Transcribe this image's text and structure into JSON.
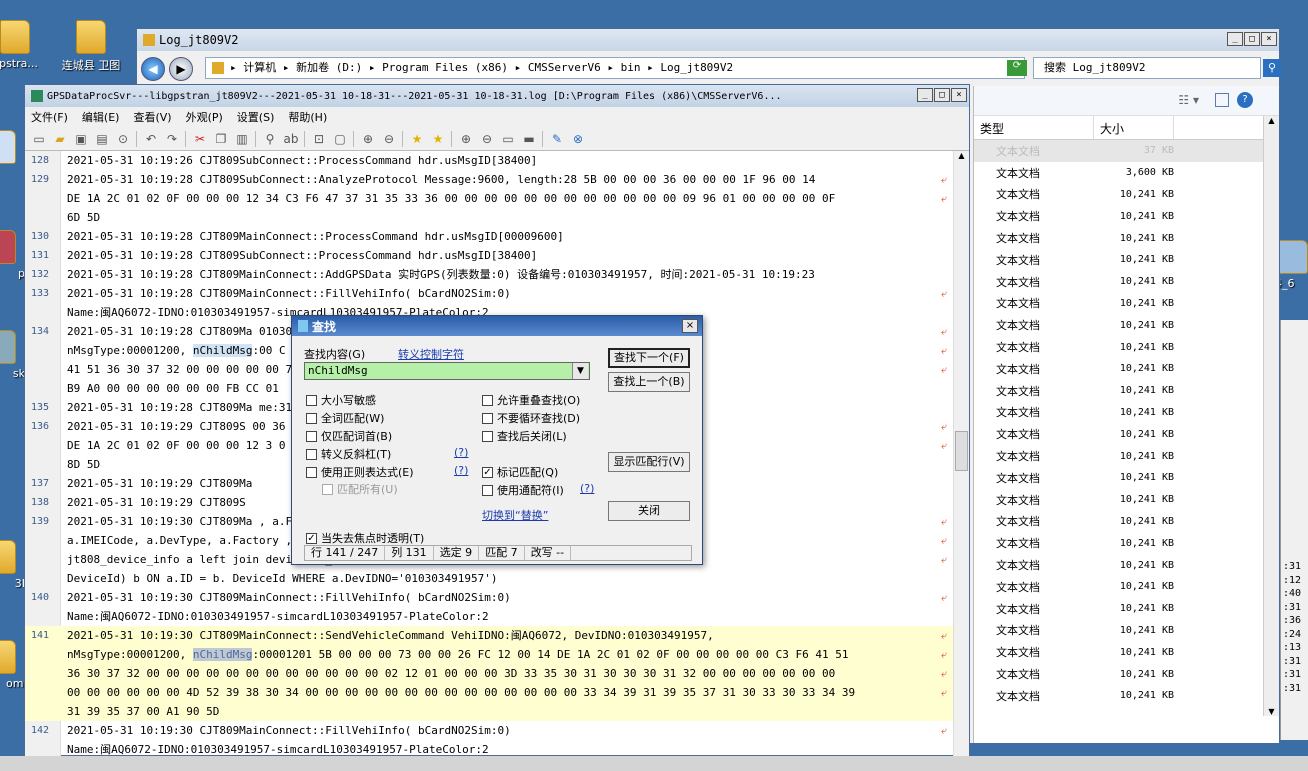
{
  "desktop": {
    "icons": [
      {
        "label": "gpstra..."
      },
      {
        "label": "连城县 卫图"
      },
      {
        "label": "lic"
      },
      {
        "label": "pto"
      },
      {
        "label": "skto"
      },
      {
        "label": "3Ds"
      },
      {
        "label": "omse"
      }
    ],
    "right_labels": [
      "64_6"
    ]
  },
  "explorer": {
    "title": "Log_jt809V2",
    "path_parts": [
      "计算机",
      "新加卷 (D:)",
      "Program Files (x86)",
      "CMSServerV6",
      "bin",
      "Log_jt809V2"
    ],
    "search_placeholder": "搜索 Log_jt809V2",
    "columns": {
      "type": "类型",
      "size": "大小"
    },
    "files": [
      {
        "type": "文本文档",
        "size": "37 KB"
      },
      {
        "type": "文本文档",
        "size": "3,600 KB"
      },
      {
        "type": "文本文档",
        "size": "10,241 KB"
      },
      {
        "type": "文本文档",
        "size": "10,241 KB"
      },
      {
        "type": "文本文档",
        "size": "10,241 KB"
      },
      {
        "type": "文本文档",
        "size": "10,241 KB"
      },
      {
        "type": "文本文档",
        "size": "10,241 KB"
      },
      {
        "type": "文本文档",
        "size": "10,241 KB"
      },
      {
        "type": "文本文档",
        "size": "10,241 KB"
      },
      {
        "type": "文本文档",
        "size": "10,241 KB"
      },
      {
        "type": "文本文档",
        "size": "10,241 KB"
      },
      {
        "type": "文本文档",
        "size": "10,241 KB"
      },
      {
        "type": "文本文档",
        "size": "10,241 KB"
      },
      {
        "type": "文本文档",
        "size": "10,241 KB"
      },
      {
        "type": "文本文档",
        "size": "10,241 KB"
      },
      {
        "type": "文本文档",
        "size": "10,241 KB"
      },
      {
        "type": "文本文档",
        "size": "10,241 KB"
      },
      {
        "type": "文本文档",
        "size": "10,241 KB"
      },
      {
        "type": "文本文档",
        "size": "10,241 KB"
      },
      {
        "type": "文本文档",
        "size": "10,241 KB"
      },
      {
        "type": "文本文档",
        "size": "10,241 KB"
      },
      {
        "type": "文本文档",
        "size": "10,241 KB"
      },
      {
        "type": "文本文档",
        "size": "10,241 KB"
      },
      {
        "type": "文本文档",
        "size": "10,241 KB"
      },
      {
        "type": "文本文档",
        "size": "10,241 KB"
      },
      {
        "type": "文本文档",
        "size": "10,241 KB"
      }
    ],
    "edge_times": [
      ":31",
      ":12",
      ":40",
      ":31",
      ":36",
      ":24",
      ":13",
      ":31",
      ":31",
      ":31"
    ]
  },
  "editor": {
    "title": "GPSDataProcSvr---libgpstran_jt809V2---2021-05-31 10-18-31---2021-05-31 10-18-31.log [D:\\Program Files (x86)\\CMSServerV6...",
    "menu": [
      "文件(F)",
      "编辑(E)",
      "查看(V)",
      "外观(P)",
      "设置(S)",
      "帮助(H)"
    ],
    "lines": [
      {
        "n": "128",
        "t": "2021-05-31   10:19:26   CJT809SubConnect::ProcessCommand hdr.usMsgID[38400]",
        "wrap": false
      },
      {
        "n": "129",
        "t": "2021-05-31   10:19:28   CJT809SubConnect::AnalyzeProtocol Message:9600, length:28  5B 00 00 00 36 00 00 00 1F 96 00 14",
        "wrap": true
      },
      {
        "n": "",
        "t": "DE 1A 2C 01 02 0F 00 00 00 12 34 C3 F6 47 37 31 35 33 36 00 00 00 00 00 00 00 00 00 00 00 00 09 96 01 00 00 00 00 0F",
        "wrap": true
      },
      {
        "n": "",
        "t": "6D 5D",
        "wrap": false
      },
      {
        "n": "130",
        "t": "2021-05-31   10:19:28   CJT809MainConnect::ProcessCommand hdr.usMsgID[00009600]",
        "wrap": false
      },
      {
        "n": "131",
        "t": "2021-05-31   10:19:28   CJT809SubConnect::ProcessCommand hdr.usMsgID[38400]",
        "wrap": false
      },
      {
        "n": "132",
        "t": "2021-05-31   10:19:28   CJT809MainConnect::AddGPSData 实时GPS(列表数量:0) 设备编号:010303491957, 时间:2021-05-31 10:19:23",
        "wrap": false
      },
      {
        "n": "133",
        "t": "2021-05-31   10:19:28   CJT809MainConnect::FillVehiInfo( bCardNO2Sim:0)",
        "wrap": true
      },
      {
        "n": "",
        "t": "Name:闽AQ6072-IDNO:010303491957-simcardL10303491957-PlateColor:2",
        "wrap": false
      },
      {
        "n": "134",
        "t": "2021-05-31   10:19:28   CJT809Ma                                                  010303491957,",
        "wrap": true
      },
      {
        "n": "",
        "t": "nMsgType:00001200, nChildMsg:00                                                   C 01 02 0F 00 00 00 00 00 C3 F6",
        "wrap": true
      },
      {
        "n": "",
        "t": "41 51 36 30 37 32 00 00 00 00 00                                                  7 E5 0A 13 17 07 1C 36 3B 01 8C",
        "wrap": true
      },
      {
        "n": "",
        "t": "B9 A0 00 00 00 00 00 00 FB CC 01",
        "wrap": false
      },
      {
        "n": "135",
        "t": "2021-05-31   10:19:28   CJT809Ma                                                  me:31 10:19:23",
        "wrap": false
      },
      {
        "n": "136",
        "t": "2021-05-31   10:19:29   CJT809S                                                    00 36 00 00 00 20 96 00 14",
        "wrap": true
      },
      {
        "n": "",
        "t": "DE 1A 2C 01 02 0F 00 00 00 12 3                                                  0 00 00 02 96 01 00 00 00 00 C5",
        "wrap": true
      },
      {
        "n": "",
        "t": "8D 5D",
        "wrap": false
      },
      {
        "n": "137",
        "t": "2021-05-31   10:19:29   CJT809Ma",
        "wrap": false
      },
      {
        "n": "138",
        "t": "2021-05-31   10:19:29   CJT809S",
        "wrap": false
      },
      {
        "n": "139",
        "t": "2021-05-31   10:19:30   CJT809Ma                                                  , a.Factory, a.SimCard,",
        "wrap": true
      },
      {
        "n": "",
        "t": "a.IMEICode, a.DevType, a.Factory                                                  , b.chnCount from",
        "wrap": true
      },
      {
        "n": "",
        "t": "jt808_device_info a left join                                                     devicechn_relation GROUP BY",
        "wrap": true
      },
      {
        "n": "",
        "t": "DeviceId) b ON a.ID = b. DeviceId WHERE a.DevIDNO='010303491957')",
        "wrap": false
      },
      {
        "n": "140",
        "t": "2021-05-31   10:19:30   CJT809MainConnect::FillVehiInfo( bCardNO2Sim:0)",
        "wrap": true
      },
      {
        "n": "",
        "t": "Name:闽AQ6072-IDNO:010303491957-simcardL10303491957-PlateColor:2",
        "wrap": false
      },
      {
        "n": "141",
        "t": "2021-05-31   10:19:30   CJT809MainConnect::SendVehicleCommand VehiIDNO:闽AQ6072, DevIDNO:010303491957,",
        "wrap": true
      },
      {
        "n": "",
        "t": "nMsgType:00001200, nChildMsg:00001201  5B 00 00 00 73 00 00 26 FC 12 00 14 DE 1A 2C 01 02 0F 00 00 00 00 00 C3 F6 41 51",
        "wrap": true
      },
      {
        "n": "",
        "t": "36 30 37 32 00 00 00 00 00 00 00 00 00 00 00 00 02 12 01 00 00 00 3D 33 35 30 31 30 30 30 31 32 00 00 00 00 00 00 00",
        "wrap": true
      },
      {
        "n": "",
        "t": "00 00 00 00 00 00 4D 52 39 38 30 34 00 00 00 00 00 00 00 00 00 00 00 00 00 00 33 34 39 31 39 35 37 31 30 33 30 33 34 39",
        "wrap": true
      },
      {
        "n": "",
        "t": "31 39 35 37 00 A1 90 5D",
        "wrap": false
      },
      {
        "n": "142",
        "t": "2021-05-31   10:19:30   CJT809MainConnect::FillVehiInfo( bCardNO2Sim:0)",
        "wrap": true
      },
      {
        "n": "",
        "t": "Name:闽AQ6072-IDNO:010303491957-simcardL10303491957-PlateColor:2",
        "wrap": false
      }
    ]
  },
  "find": {
    "title": "查找",
    "label_find": "查找内容(G)",
    "escape_link": "转义控制字符",
    "value": "nChildMsg",
    "btn_next": "查找下一个(F)",
    "btn_prev": "查找上一个(B)",
    "btn_show_all": "显示匹配行(V)",
    "btn_close": "关闭",
    "switch_link": "切换到“替换”",
    "help1": "(?)",
    "help2": "(?)",
    "help3": "(?)",
    "options_left": [
      {
        "label": "大小写敏感",
        "checked": false
      },
      {
        "label": "全词匹配(W)",
        "checked": false
      },
      {
        "label": "仅匹配词首(B)",
        "checked": false
      },
      {
        "label": "转义反斜杠(T)",
        "checked": false
      },
      {
        "label": "使用正则表达式(E)",
        "checked": false
      },
      {
        "label": "匹配所有(U)",
        "checked": false
      }
    ],
    "options_right": [
      {
        "label": "允许重叠查找(O)",
        "checked": false
      },
      {
        "label": "不要循环查找(D)",
        "checked": false
      },
      {
        "label": "查找后关闭(L)",
        "checked": false
      },
      {
        "label": "标记匹配(Q)",
        "checked": true
      },
      {
        "label": "使用通配符(I)",
        "checked": false
      }
    ],
    "transparent": {
      "label": "当失去焦点时透明(T)",
      "checked": true
    },
    "status": {
      "row": "行  141 / 247",
      "col": "列  131",
      "sel": "选定  9",
      "match": "匹配  7",
      "mod": "改写  --"
    }
  },
  "colors": {
    "highlight": "#fefed0",
    "mark": "#cfe3f5",
    "accent": "#2b5ea8",
    "link": "#1a3cb0"
  }
}
